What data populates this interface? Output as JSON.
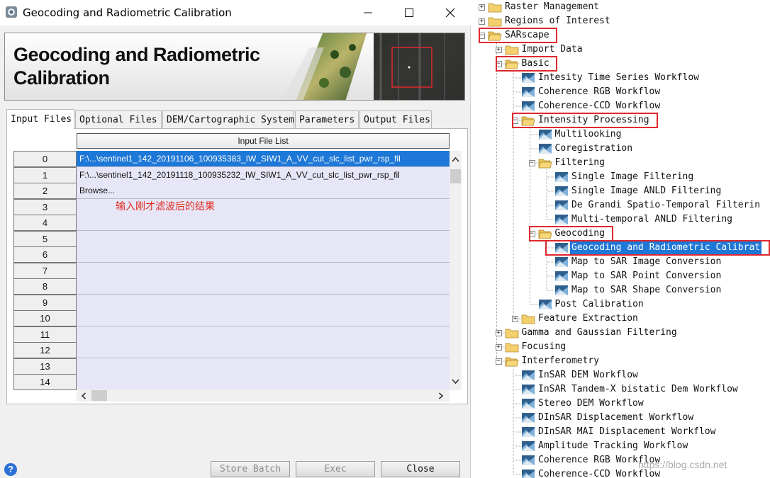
{
  "window": {
    "title": "Geocoding and Radiometric Calibration",
    "controls": {
      "minimize": "—",
      "maximize": "☐",
      "close": "✕"
    }
  },
  "banner": {
    "title_line1": "Geocoding and Radiometric",
    "title_line2": "Calibration"
  },
  "tabs": [
    {
      "label": "Input Files",
      "active": true
    },
    {
      "label": "Optional Files",
      "active": false
    },
    {
      "label": "DEM/Cartographic System",
      "active": false
    },
    {
      "label": "Parameters",
      "active": false
    },
    {
      "label": "Output Files",
      "active": false
    }
  ],
  "table": {
    "column_header": "Input File List",
    "rows": [
      {
        "index": "0",
        "value": "F:\\...\\sentinel1_142_20191106_100935383_IW_SIW1_A_VV_cut_slc_list_pwr_rsp_fil",
        "selected": true
      },
      {
        "index": "1",
        "value": "F:\\...\\sentinel1_142_20191118_100935232_IW_SIW1_A_VV_cut_slc_list_pwr_rsp_fil",
        "selected": false
      },
      {
        "index": "2",
        "value": "Browse...",
        "selected": false
      },
      {
        "index": "3",
        "value": "",
        "selected": false
      },
      {
        "index": "4",
        "value": "",
        "selected": false
      },
      {
        "index": "5",
        "value": "",
        "selected": false
      },
      {
        "index": "6",
        "value": "",
        "selected": false
      },
      {
        "index": "7",
        "value": "",
        "selected": false
      },
      {
        "index": "8",
        "value": "",
        "selected": false
      },
      {
        "index": "9",
        "value": "",
        "selected": false
      },
      {
        "index": "10",
        "value": "",
        "selected": false
      },
      {
        "index": "11",
        "value": "",
        "selected": false
      },
      {
        "index": "12",
        "value": "",
        "selected": false
      },
      {
        "index": "13",
        "value": "",
        "selected": false
      },
      {
        "index": "14",
        "value": "",
        "selected": false
      }
    ],
    "annotation": "输入刚才滤波后的结果"
  },
  "buttons": {
    "store_batch": "Store Batch",
    "exec": "Exec",
    "close": "Close",
    "help": "?"
  },
  "tree": {
    "nodes": [
      {
        "label": "Raster Management",
        "type": "folder",
        "level": 0,
        "toggle": "+"
      },
      {
        "label": "Regions of Interest",
        "type": "folder",
        "level": 0,
        "toggle": "+"
      },
      {
        "label": "SARscape",
        "type": "folder-open",
        "level": 0,
        "toggle": "−",
        "highlight": true
      },
      {
        "label": "Import Data",
        "type": "folder",
        "level": 1,
        "toggle": "+"
      },
      {
        "label": "Basic",
        "type": "folder-open",
        "level": 1,
        "toggle": "−",
        "highlight": true
      },
      {
        "label": "Intesity Time Series Workflow",
        "type": "tool",
        "level": 2
      },
      {
        "label": "Coherence RGB Workflow",
        "type": "tool",
        "level": 2
      },
      {
        "label": "Coherence-CCD Workflow",
        "type": "tool",
        "level": 2
      },
      {
        "label": "Intensity Processing",
        "type": "folder-open",
        "level": 2,
        "toggle": "−",
        "highlight": true
      },
      {
        "label": "Multilooking",
        "type": "tool",
        "level": 3
      },
      {
        "label": "Coregistration",
        "type": "tool",
        "level": 3
      },
      {
        "label": "Filtering",
        "type": "folder-open",
        "level": 3,
        "toggle": "−"
      },
      {
        "label": "Single Image Filtering",
        "type": "tool",
        "level": 4
      },
      {
        "label": "Single Image ANLD Filtering",
        "type": "tool",
        "level": 4
      },
      {
        "label": "De Grandi Spatio-Temporal Filterin",
        "type": "tool",
        "level": 4
      },
      {
        "label": "Multi-temporal ANLD Filtering",
        "type": "tool",
        "level": 4
      },
      {
        "label": "Geocoding",
        "type": "folder-open",
        "level": 3,
        "toggle": "−",
        "highlight": true
      },
      {
        "label": "Geocoding and Radiometric Calibrat",
        "type": "tool",
        "level": 4,
        "selected": true,
        "highlight": true
      },
      {
        "label": "Map to SAR Image Conversion",
        "type": "tool",
        "level": 4
      },
      {
        "label": "Map to SAR Point Conversion",
        "type": "tool",
        "level": 4
      },
      {
        "label": "Map to SAR Shape Conversion",
        "type": "tool",
        "level": 4
      },
      {
        "label": "Post Calibration",
        "type": "tool",
        "level": 3
      },
      {
        "label": "Feature Extraction",
        "type": "folder",
        "level": 2,
        "toggle": "+"
      },
      {
        "label": "Gamma and Gaussian Filtering",
        "type": "folder",
        "level": 1,
        "toggle": "+"
      },
      {
        "label": "Focusing",
        "type": "folder",
        "level": 1,
        "toggle": "+"
      },
      {
        "label": "Interferometry",
        "type": "folder-open",
        "level": 1,
        "toggle": "−"
      },
      {
        "label": "InSAR DEM Workflow",
        "type": "tool",
        "level": 2
      },
      {
        "label": "InSAR Tandem-X bistatic Dem Workflow",
        "type": "tool",
        "level": 2
      },
      {
        "label": "Stereo DEM Workflow",
        "type": "tool",
        "level": 2
      },
      {
        "label": "DInSAR Displacement Workflow",
        "type": "tool",
        "level": 2
      },
      {
        "label": "DInSAR MAI Displacement Workflow",
        "type": "tool",
        "level": 2
      },
      {
        "label": "Amplitude Tracking Workflow",
        "type": "tool",
        "level": 2
      },
      {
        "label": "Coherence RGB Workflow",
        "type": "tool",
        "level": 2
      },
      {
        "label": "Coherence-CCD Workflow",
        "type": "tool",
        "level": 2
      }
    ]
  },
  "watermark": "https://blog.csdn.net",
  "colors": {
    "highlight_red": "#e0282e",
    "selection_blue": "#1e78d7",
    "table_cell": "#e6e6f6"
  }
}
